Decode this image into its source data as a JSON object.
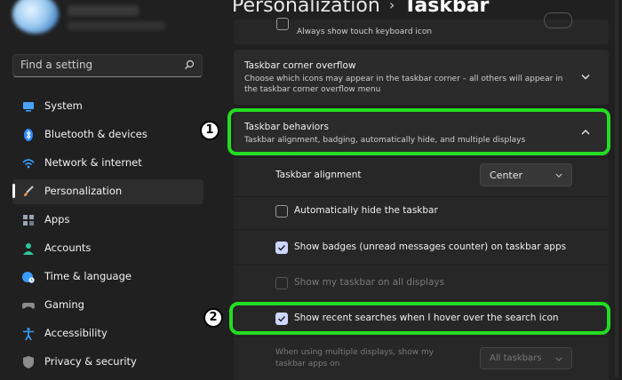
{
  "search": {
    "placeholder": "Find a setting"
  },
  "sidebar": {
    "items": [
      {
        "label": "System",
        "icon": "system-icon",
        "color": "#4aa3ff"
      },
      {
        "label": "Bluetooth & devices",
        "icon": "bluetooth-icon",
        "color": "#2f8cff"
      },
      {
        "label": "Network & internet",
        "icon": "wifi-icon",
        "color": "#3aa0ff"
      },
      {
        "label": "Personalization",
        "icon": "brush-icon",
        "color": "#e5904a",
        "active": true
      },
      {
        "label": "Apps",
        "icon": "apps-icon",
        "color": "#9aa4b4"
      },
      {
        "label": "Accounts",
        "icon": "accounts-icon",
        "color": "#2ec5a0"
      },
      {
        "label": "Time & language",
        "icon": "globe-clock-icon",
        "color": "#3a9bff"
      },
      {
        "label": "Gaming",
        "icon": "gamepad-icon",
        "color": "#8c8c8c"
      },
      {
        "label": "Accessibility",
        "icon": "accessibility-icon",
        "color": "#3aa0ff"
      },
      {
        "label": "Privacy & security",
        "icon": "shield-icon",
        "color": "#8c8c8c"
      }
    ]
  },
  "header": {
    "section": "Personalization",
    "separator": "›",
    "page": "Taskbar"
  },
  "main": {
    "touch_keyboard": "Always show touch keyboard icon",
    "corner_overflow": {
      "title": "Taskbar corner overflow",
      "desc": "Choose which icons may appear in the taskbar corner – all others will appear in the taskbar corner overflow menu"
    },
    "behaviors": {
      "title": "Taskbar behaviors",
      "desc": "Taskbar alignment, badging, automatically hide, and multiple displays"
    },
    "alignment": {
      "label": "Taskbar alignment",
      "value": "Center"
    },
    "auto_hide": {
      "label": "Automatically hide the taskbar",
      "checked": false
    },
    "badges": {
      "label": "Show badges (unread messages counter) on taskbar apps",
      "checked": true
    },
    "all_displays": {
      "label": "Show my taskbar on all displays",
      "checked": false,
      "disabled": true
    },
    "recent_searches": {
      "label": "Show recent searches when I hover over the search icon",
      "checked": true
    },
    "multi_display": {
      "label_line1": "When using multiple displays, show my",
      "label_line2": "taskbar apps on",
      "value": "All taskbars"
    }
  },
  "annotations": {
    "step1": "1",
    "step2": "2",
    "highlight_color": "#22dd22"
  },
  "colors": {
    "background": "#202020",
    "card": "#2b2b2b",
    "accent_check": "#cdd6ff"
  }
}
